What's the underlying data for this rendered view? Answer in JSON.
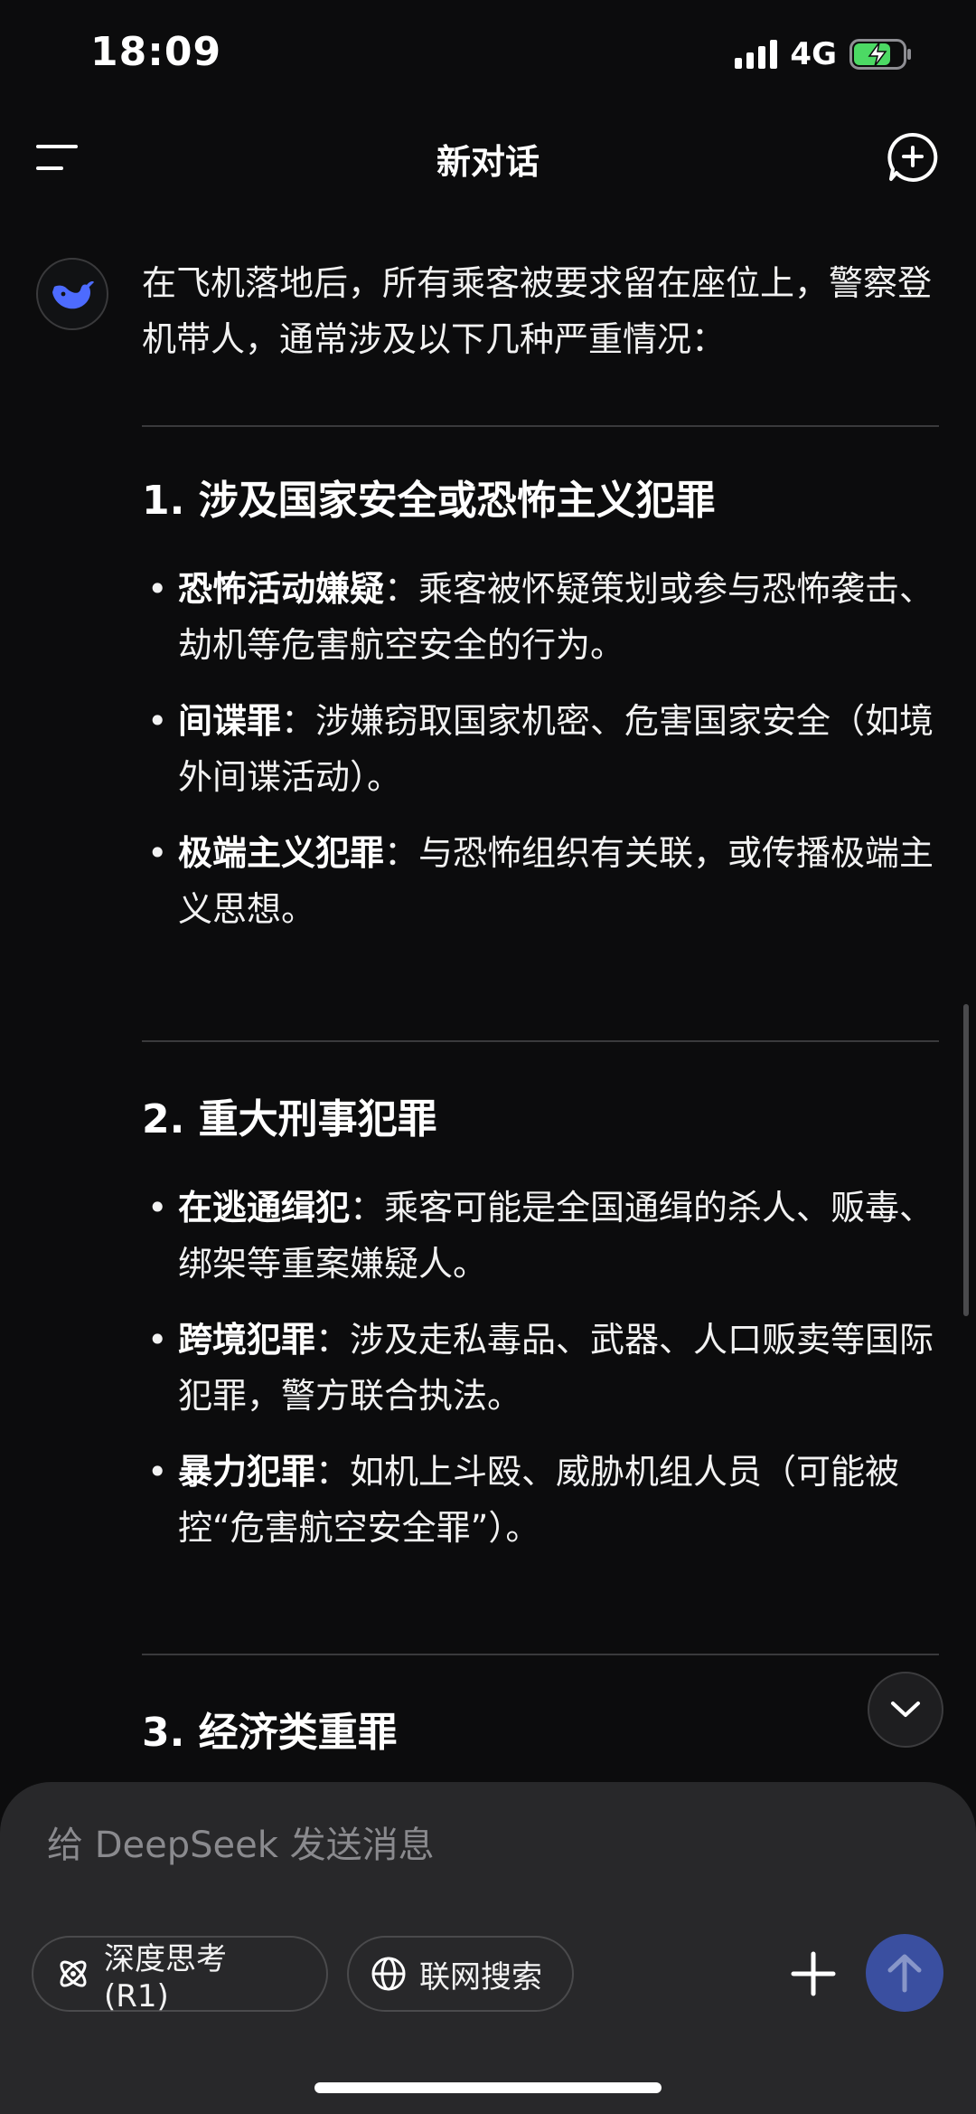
{
  "status_bar": {
    "time": "18:09",
    "network": "4G",
    "battery_color": "#4cd964"
  },
  "nav": {
    "title": "新对话"
  },
  "message": {
    "intro": "在飞机落地后，所有乘客被要求留在座位上，警察登机带人，通常涉及以下几种严重情况：",
    "sections": [
      {
        "title": "1. 涉及国家安全或恐怖主义犯罪",
        "items": [
          {
            "term": "恐怖活动嫌疑",
            "text": "：乘客被怀疑策划或参与恐怖袭击、劫机等危害航空安全的行为。"
          },
          {
            "term": "间谍罪",
            "text": "：涉嫌窃取国家机密、危害国家安全（如境外间谍活动）。"
          },
          {
            "term": "极端主义犯罪",
            "text": "：与恐怖组织有关联，或传播极端主义思想。"
          }
        ]
      },
      {
        "title": "2. 重大刑事犯罪",
        "items": [
          {
            "term": "在逃通缉犯",
            "text": "：乘客可能是全国通缉的杀人、贩毒、绑架等重案嫌疑人。"
          },
          {
            "term": "跨境犯罪",
            "text": "：涉及走私毒品、武器、人口贩卖等国际犯罪，警方联合执法。"
          },
          {
            "term": "暴力犯罪",
            "text": "：如机上斗殴、威胁机组人员（可能被控“危害航空安全罪”）。"
          }
        ]
      },
      {
        "title": "3. 经济类重罪"
      }
    ]
  },
  "composer": {
    "placeholder": "给 DeepSeek 发送消息",
    "deep_think_label": "深度思考 (R1)",
    "web_search_label": "联网搜索",
    "accent_color": "#3a4fa0"
  },
  "icons": {
    "menu": "menu-icon",
    "new_chat": "new-chat-icon",
    "avatar": "deepseek-whale-icon",
    "scroll_down": "chevron-down-icon",
    "deep_think": "atom-icon",
    "web_search": "globe-icon",
    "plus": "plus-icon",
    "send": "arrow-up-icon"
  }
}
